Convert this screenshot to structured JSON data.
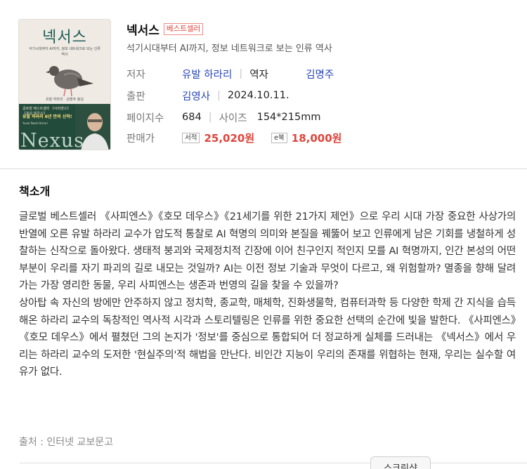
{
  "book": {
    "cover": {
      "title": "넥서스",
      "subtitle": "석기시대부터 AI까지, 정보 네트워크로 보는 인류 역사",
      "author": "유발 하라리 · 김명주 옮김",
      "band_line1": "글로벌 베스트셀러 《사피엔스》《호모 데우스》",
      "band_line2": "유발 하라리 6년 만의 신작!",
      "band_line3": "Yuval Noah Harari",
      "english_title": "Nexus"
    },
    "title": "넥서스",
    "badge": "베스트셀러",
    "subtitle": "석기시대부터 AI까지, 정보 네트워크로 보는 인류 역사",
    "author_label": "저자",
    "author": "유발 하라리",
    "translator_label": "역자",
    "translator": "김명주",
    "publisher_label": "출판",
    "publisher": "김영사",
    "date": "2024.10.11.",
    "pages_label": "페이지수",
    "pages": "684",
    "size_label": "사이즈",
    "size": "154*215mm",
    "price_label": "판매가",
    "print_tag": "서적",
    "print_price": "25,020원",
    "ebook_tag": "e북",
    "ebook_price": "18,000원"
  },
  "intro": {
    "title": "책소개",
    "paragraph1": "글로벌 베스트셀러 《사피엔스》《호모 데우스》《21세기를 위한 21가지 제언》으로 우리 시대 가장 중요한 사상가의 반열에 오른 유발 하라리 교수가 압도적 통찰로 AI 혁명의 의미와 본질을 꿰뚫어 보고 인류에게 남은 기회를 냉철하게 성찰하는 신작으로 돌아왔다. 생태적 붕괴와 국제정치적 긴장에 이어 친구인지 적인지 모를 AI 혁명까지, 인간 본성의 어떤 부분이 우리를 자기 파괴의 길로 내모는 것일까? AI는 이전 정보 기술과 무엇이 다르고, 왜 위험할까? 멸종을 향해 달려가는 가장 영리한 동물, 우리 사피엔스는 생존과 번영의 길을 찾을 수 있을까?",
    "paragraph2": "상아탑 속 자신의 방에만 안주하지 않고 정치학, 종교학, 매체학, 진화생물학, 컴퓨터과학 등 다양한 학제 간 지식을 습득해온 하라리 교수의 독창적인 역사적 시각과 스토리텔링은 인류를 위한 중요한 선택의 순간에 빛을 발한다. 《사피엔스》《호모 데우스》에서 펼쳤던 그의 논지가 '정보'를 중심으로 통합되어 더 정교하게 실체를 드러내는 《넥서스》에서 우리는 하라리 교수의 도저한 '현실주의'적 해법을 만난다. 비인간 지능이 우리의 존재를 위협하는 현재, 우리는 실수할 여유가 없다.",
    "source": "출처 : 인터넷 교보문고"
  },
  "footer": {
    "screenshot_label": "스크린샷"
  }
}
